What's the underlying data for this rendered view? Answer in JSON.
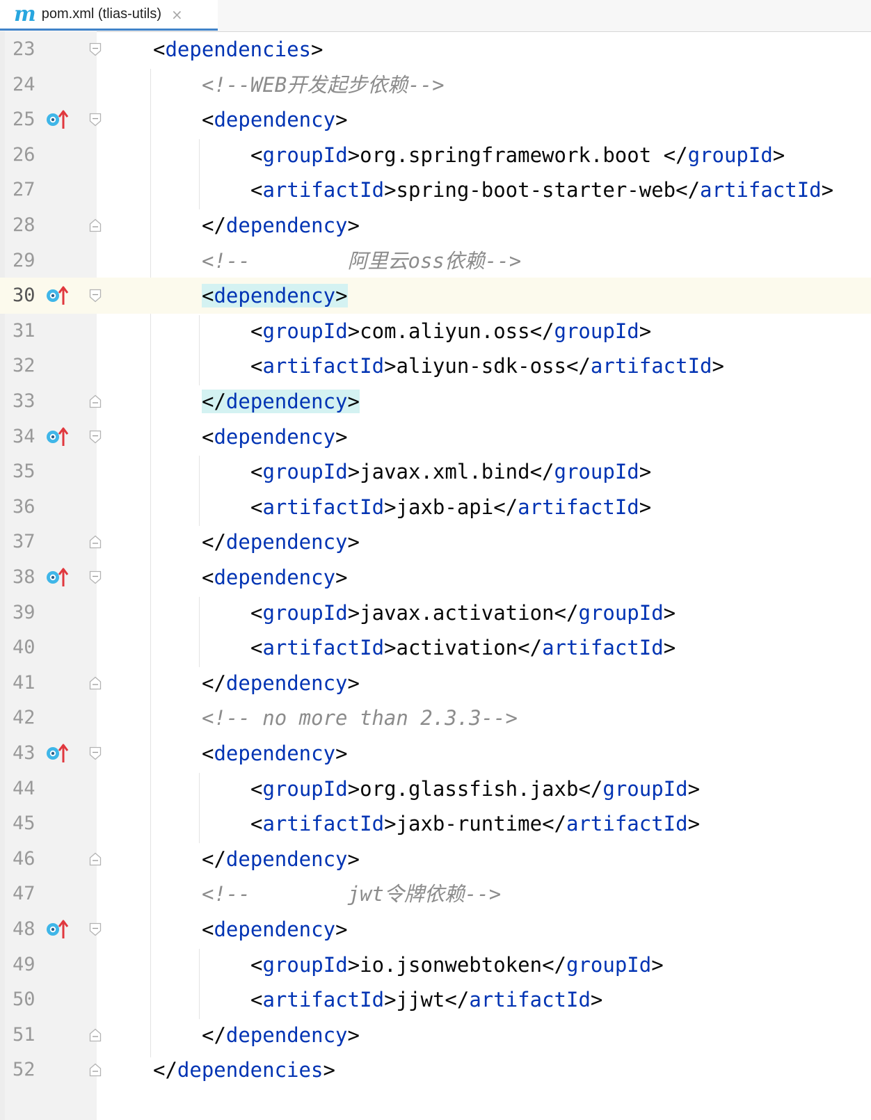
{
  "tab": {
    "icon": "m",
    "label": "pom.xml (tlias-utils)",
    "close": "×"
  },
  "lines": [
    {
      "n": "23",
      "indent": 1,
      "fold": "open",
      "marker": false,
      "current": false,
      "kind": "open",
      "tag": "dependencies"
    },
    {
      "n": "24",
      "indent": 2,
      "fold": "none",
      "marker": false,
      "current": false,
      "kind": "comment",
      "text": "<!--WEB开发起步依赖-->"
    },
    {
      "n": "25",
      "indent": 2,
      "fold": "open",
      "marker": true,
      "current": false,
      "kind": "open",
      "tag": "dependency"
    },
    {
      "n": "26",
      "indent": 3,
      "fold": "none",
      "marker": false,
      "current": false,
      "kind": "elem",
      "tag": "groupId",
      "value": "org.springframework.boot "
    },
    {
      "n": "27",
      "indent": 3,
      "fold": "none",
      "marker": false,
      "current": false,
      "kind": "elem",
      "tag": "artifactId",
      "value": "spring-boot-starter-web"
    },
    {
      "n": "28",
      "indent": 2,
      "fold": "close",
      "marker": false,
      "current": false,
      "kind": "close",
      "tag": "dependency"
    },
    {
      "n": "29",
      "indent": 2,
      "fold": "none",
      "marker": false,
      "current": false,
      "kind": "comment",
      "text": "<!--        阿里云oss依赖-->"
    },
    {
      "n": "30",
      "indent": 2,
      "fold": "open",
      "marker": true,
      "current": true,
      "kind": "open",
      "tag": "dependency",
      "highlight": true
    },
    {
      "n": "31",
      "indent": 3,
      "fold": "none",
      "marker": false,
      "current": false,
      "kind": "elem",
      "tag": "groupId",
      "value": "com.aliyun.oss"
    },
    {
      "n": "32",
      "indent": 3,
      "fold": "none",
      "marker": false,
      "current": false,
      "kind": "elem",
      "tag": "artifactId",
      "value": "aliyun-sdk-oss"
    },
    {
      "n": "33",
      "indent": 2,
      "fold": "close",
      "marker": false,
      "current": false,
      "kind": "close",
      "tag": "dependency",
      "highlight": true
    },
    {
      "n": "34",
      "indent": 2,
      "fold": "open",
      "marker": true,
      "current": false,
      "kind": "open",
      "tag": "dependency"
    },
    {
      "n": "35",
      "indent": 3,
      "fold": "none",
      "marker": false,
      "current": false,
      "kind": "elem",
      "tag": "groupId",
      "value": "javax.xml.bind"
    },
    {
      "n": "36",
      "indent": 3,
      "fold": "none",
      "marker": false,
      "current": false,
      "kind": "elem",
      "tag": "artifactId",
      "value": "jaxb-api"
    },
    {
      "n": "37",
      "indent": 2,
      "fold": "close",
      "marker": false,
      "current": false,
      "kind": "close",
      "tag": "dependency"
    },
    {
      "n": "38",
      "indent": 2,
      "fold": "open",
      "marker": true,
      "current": false,
      "kind": "open",
      "tag": "dependency"
    },
    {
      "n": "39",
      "indent": 3,
      "fold": "none",
      "marker": false,
      "current": false,
      "kind": "elem",
      "tag": "groupId",
      "value": "javax.activation"
    },
    {
      "n": "40",
      "indent": 3,
      "fold": "none",
      "marker": false,
      "current": false,
      "kind": "elem",
      "tag": "artifactId",
      "value": "activation"
    },
    {
      "n": "41",
      "indent": 2,
      "fold": "close",
      "marker": false,
      "current": false,
      "kind": "close",
      "tag": "dependency"
    },
    {
      "n": "42",
      "indent": 2,
      "fold": "none",
      "marker": false,
      "current": false,
      "kind": "comment",
      "text": "<!-- no more than 2.3.3-->"
    },
    {
      "n": "43",
      "indent": 2,
      "fold": "open",
      "marker": true,
      "current": false,
      "kind": "open",
      "tag": "dependency"
    },
    {
      "n": "44",
      "indent": 3,
      "fold": "none",
      "marker": false,
      "current": false,
      "kind": "elem",
      "tag": "groupId",
      "value": "org.glassfish.jaxb"
    },
    {
      "n": "45",
      "indent": 3,
      "fold": "none",
      "marker": false,
      "current": false,
      "kind": "elem",
      "tag": "artifactId",
      "value": "jaxb-runtime"
    },
    {
      "n": "46",
      "indent": 2,
      "fold": "close",
      "marker": false,
      "current": false,
      "kind": "close",
      "tag": "dependency"
    },
    {
      "n": "47",
      "indent": 2,
      "fold": "none",
      "marker": false,
      "current": false,
      "kind": "comment",
      "text": "<!--        jwt令牌依赖-->"
    },
    {
      "n": "48",
      "indent": 2,
      "fold": "open",
      "marker": true,
      "current": false,
      "kind": "open",
      "tag": "dependency"
    },
    {
      "n": "49",
      "indent": 3,
      "fold": "none",
      "marker": false,
      "current": false,
      "kind": "elem",
      "tag": "groupId",
      "value": "io.jsonwebtoken"
    },
    {
      "n": "50",
      "indent": 3,
      "fold": "none",
      "marker": false,
      "current": false,
      "kind": "elem",
      "tag": "artifactId",
      "value": "jjwt"
    },
    {
      "n": "51",
      "indent": 2,
      "fold": "close",
      "marker": false,
      "current": false,
      "kind": "close",
      "tag": "dependency"
    },
    {
      "n": "52",
      "indent": 1,
      "fold": "close",
      "marker": false,
      "current": false,
      "kind": "close",
      "tag": "dependencies"
    }
  ],
  "colors": {
    "tag": "#0033b3",
    "comment": "#8c8c8c",
    "text": "#080808",
    "bracket_highlight": "#d4f2f2",
    "current_line": "#fcfaed",
    "marker_blue": "#3fb6e8",
    "marker_red": "#e0383e"
  },
  "icons": {
    "tab": "maven-icon",
    "close": "close-icon",
    "marker": "implemented-overridden-gutter-icon",
    "fold_open": "fold-collapse-icon",
    "fold_close": "fold-end-icon"
  }
}
